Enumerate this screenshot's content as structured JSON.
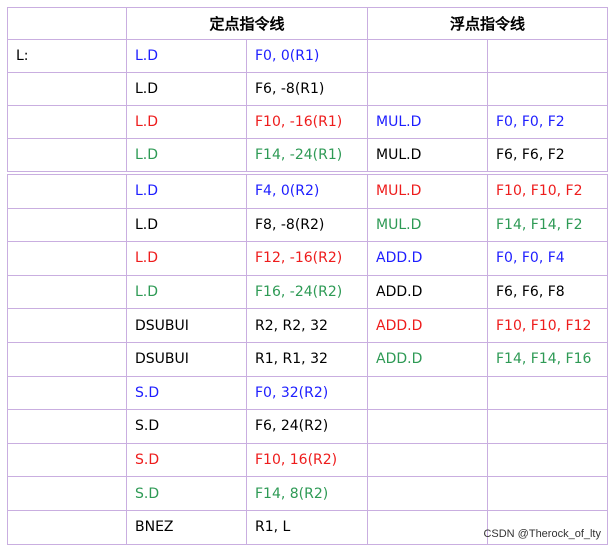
{
  "colors": {
    "black": "#000000",
    "blue": "#1e1eff",
    "red": "#ee1c1c",
    "green": "#2e9a55"
  },
  "headers": {
    "fixed": "定点指令线",
    "float": "浮点指令线"
  },
  "table1": [
    {
      "label": "L:",
      "op1": {
        "text": "L.D",
        "color": "blue"
      },
      "arg1": {
        "text": "F0, 0(R1)",
        "color": "blue"
      },
      "op2": {
        "text": "",
        "color": "black"
      },
      "arg2": {
        "text": "",
        "color": "black"
      }
    },
    {
      "label": "",
      "op1": {
        "text": "L.D",
        "color": "black"
      },
      "arg1": {
        "text": "F6, -8(R1)",
        "color": "black"
      },
      "op2": {
        "text": "",
        "color": "black"
      },
      "arg2": {
        "text": "",
        "color": "black"
      }
    },
    {
      "label": "",
      "op1": {
        "text": "L.D",
        "color": "red"
      },
      "arg1": {
        "text": "F10, -16(R1)",
        "color": "red"
      },
      "op2": {
        "text": "MUL.D",
        "color": "blue"
      },
      "arg2": {
        "text": "F0, F0, F2",
        "color": "blue"
      }
    },
    {
      "label": "",
      "op1": {
        "text": "L.D",
        "color": "green"
      },
      "arg1": {
        "text": "F14, -24(R1)",
        "color": "green"
      },
      "op2": {
        "text": "MUL.D",
        "color": "black"
      },
      "arg2": {
        "text": "F6, F6, F2",
        "color": "black"
      }
    }
  ],
  "table2": [
    {
      "label": "",
      "op1": {
        "text": "L.D",
        "color": "blue"
      },
      "arg1": {
        "text": "F4, 0(R2)",
        "color": "blue"
      },
      "op2": {
        "text": "MUL.D",
        "color": "red"
      },
      "arg2": {
        "text": "F10, F10, F2",
        "color": "red"
      }
    },
    {
      "label": "",
      "op1": {
        "text": "L.D",
        "color": "black"
      },
      "arg1": {
        "text": "F8, -8(R2)",
        "color": "black"
      },
      "op2": {
        "text": "MUL.D",
        "color": "green"
      },
      "arg2": {
        "text": "F14, F14, F2",
        "color": "green"
      }
    },
    {
      "label": "",
      "op1": {
        "text": "L.D",
        "color": "red"
      },
      "arg1": {
        "text": "F12, -16(R2)",
        "color": "red"
      },
      "op2": {
        "text": "ADD.D",
        "color": "blue"
      },
      "arg2": {
        "text": "F0, F0, F4",
        "color": "blue"
      }
    },
    {
      "label": "",
      "op1": {
        "text": "L.D",
        "color": "green"
      },
      "arg1": {
        "text": "F16, -24(R2)",
        "color": "green"
      },
      "op2": {
        "text": "ADD.D",
        "color": "black"
      },
      "arg2": {
        "text": "F6, F6, F8",
        "color": "black"
      }
    },
    {
      "label": "",
      "op1": {
        "text": "DSUBUI",
        "color": "black"
      },
      "arg1": {
        "text": "R2, R2, 32",
        "color": "black"
      },
      "op2": {
        "text": "ADD.D",
        "color": "red"
      },
      "arg2": {
        "text": "F10, F10, F12",
        "color": "red"
      }
    },
    {
      "label": "",
      "op1": {
        "text": "DSUBUI",
        "color": "black"
      },
      "arg1": {
        "text": "R1, R1, 32",
        "color": "black"
      },
      "op2": {
        "text": "ADD.D",
        "color": "green"
      },
      "arg2": {
        "text": "F14, F14, F16",
        "color": "green"
      }
    },
    {
      "label": "",
      "op1": {
        "text": "S.D",
        "color": "blue"
      },
      "arg1": {
        "text": "F0, 32(R2)",
        "color": "blue"
      },
      "op2": {
        "text": "",
        "color": "black"
      },
      "arg2": {
        "text": "",
        "color": "black"
      }
    },
    {
      "label": "",
      "op1": {
        "text": "S.D",
        "color": "black"
      },
      "arg1": {
        "text": "F6, 24(R2)",
        "color": "black"
      },
      "op2": {
        "text": "",
        "color": "black"
      },
      "arg2": {
        "text": "",
        "color": "black"
      }
    },
    {
      "label": "",
      "op1": {
        "text": "S.D",
        "color": "red"
      },
      "arg1": {
        "text": "F10, 16(R2)",
        "color": "red"
      },
      "op2": {
        "text": "",
        "color": "black"
      },
      "arg2": {
        "text": "",
        "color": "black"
      }
    },
    {
      "label": "",
      "op1": {
        "text": "S.D",
        "color": "green"
      },
      "arg1": {
        "text": "F14, 8(R2)",
        "color": "green"
      },
      "op2": {
        "text": "",
        "color": "black"
      },
      "arg2": {
        "text": "",
        "color": "black"
      }
    },
    {
      "label": "",
      "op1": {
        "text": "BNEZ",
        "color": "black"
      },
      "arg1": {
        "text": "R1, L",
        "color": "black"
      },
      "op2": {
        "text": "",
        "color": "black"
      },
      "arg2": {
        "text": "",
        "color": "black"
      }
    }
  ],
  "watermark": "CSDN @Therock_of_lty"
}
